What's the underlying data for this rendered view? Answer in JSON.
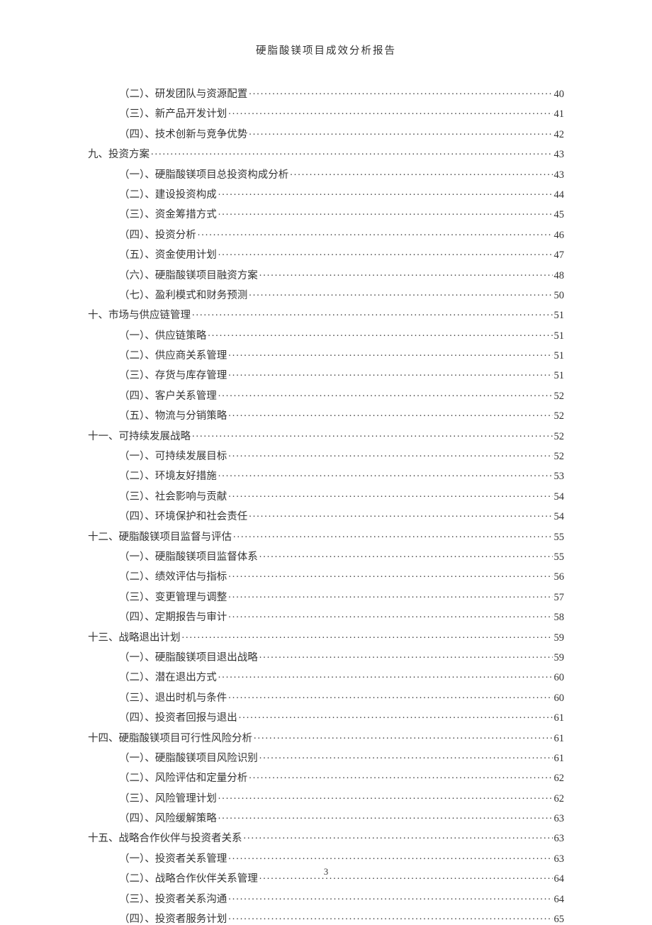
{
  "header": "硬脂酸镁项目成效分析报告",
  "page_number": "3",
  "toc": [
    {
      "indent": 1,
      "title": "（二）、研发团队与资源配置",
      "page": "40"
    },
    {
      "indent": 1,
      "title": "（三）、新产品开发计划",
      "page": "41"
    },
    {
      "indent": 1,
      "title": "（四）、技术创新与竞争优势",
      "page": "42"
    },
    {
      "indent": 0,
      "title": "九、投资方案",
      "page": "43"
    },
    {
      "indent": 1,
      "title": "（一）、硬脂酸镁项目总投资构成分析",
      "page": "43"
    },
    {
      "indent": 1,
      "title": "（二）、建设投资构成",
      "page": "44"
    },
    {
      "indent": 1,
      "title": "（三）、资金筹措方式",
      "page": "45"
    },
    {
      "indent": 1,
      "title": "（四）、投资分析",
      "page": "46"
    },
    {
      "indent": 1,
      "title": "（五）、资金使用计划",
      "page": "47"
    },
    {
      "indent": 1,
      "title": "（六）、硬脂酸镁项目融资方案",
      "page": "48"
    },
    {
      "indent": 1,
      "title": "（七）、盈利模式和财务预测",
      "page": "50"
    },
    {
      "indent": 0,
      "title": "十、市场与供应链管理",
      "page": "51"
    },
    {
      "indent": 1,
      "title": "（一）、供应链策略",
      "page": "51"
    },
    {
      "indent": 1,
      "title": "（二）、供应商关系管理",
      "page": "51"
    },
    {
      "indent": 1,
      "title": "（三）、存货与库存管理",
      "page": "51"
    },
    {
      "indent": 1,
      "title": "（四）、客户关系管理",
      "page": "52"
    },
    {
      "indent": 1,
      "title": "（五）、物流与分销策略",
      "page": "52"
    },
    {
      "indent": 0,
      "title": "十一、可持续发展战略",
      "page": "52"
    },
    {
      "indent": 1,
      "title": "（一）、可持续发展目标",
      "page": "52"
    },
    {
      "indent": 1,
      "title": "（二）、环境友好措施",
      "page": "53"
    },
    {
      "indent": 1,
      "title": "（三）、社会影响与贡献",
      "page": "54"
    },
    {
      "indent": 1,
      "title": "（四）、环境保护和社会责任",
      "page": "54"
    },
    {
      "indent": 0,
      "title": "十二、硬脂酸镁项目监督与评估",
      "page": "55"
    },
    {
      "indent": 1,
      "title": "（一）、硬脂酸镁项目监督体系",
      "page": "55"
    },
    {
      "indent": 1,
      "title": "（二）、绩效评估与指标",
      "page": "56"
    },
    {
      "indent": 1,
      "title": "（三）、变更管理与调整",
      "page": "57"
    },
    {
      "indent": 1,
      "title": "（四）、定期报告与审计",
      "page": "58"
    },
    {
      "indent": 0,
      "title": "十三、战略退出计划",
      "page": "59"
    },
    {
      "indent": 1,
      "title": "（一）、硬脂酸镁项目退出战略",
      "page": "59"
    },
    {
      "indent": 1,
      "title": "（二）、潜在退出方式",
      "page": "60"
    },
    {
      "indent": 1,
      "title": "（三）、退出时机与条件",
      "page": "60"
    },
    {
      "indent": 1,
      "title": "（四）、投资者回报与退出",
      "page": "61"
    },
    {
      "indent": 0,
      "title": "十四、硬脂酸镁项目可行性风险分析",
      "page": "61"
    },
    {
      "indent": 1,
      "title": "（一）、硬脂酸镁项目风险识别",
      "page": "61"
    },
    {
      "indent": 1,
      "title": "（二）、风险评估和定量分析",
      "page": "62"
    },
    {
      "indent": 1,
      "title": "（三）、风险管理计划",
      "page": "62"
    },
    {
      "indent": 1,
      "title": "（四）、风险缓解策略",
      "page": "63"
    },
    {
      "indent": 0,
      "title": "十五、战略合作伙伴与投资者关系",
      "page": "63"
    },
    {
      "indent": 1,
      "title": "（一）、投资者关系管理",
      "page": "63"
    },
    {
      "indent": 1,
      "title": "（二）、战略合作伙伴关系管理",
      "page": "64"
    },
    {
      "indent": 1,
      "title": "（三）、投资者关系沟通",
      "page": "64"
    },
    {
      "indent": 1,
      "title": "（四）、投资者服务计划",
      "page": "65"
    }
  ]
}
